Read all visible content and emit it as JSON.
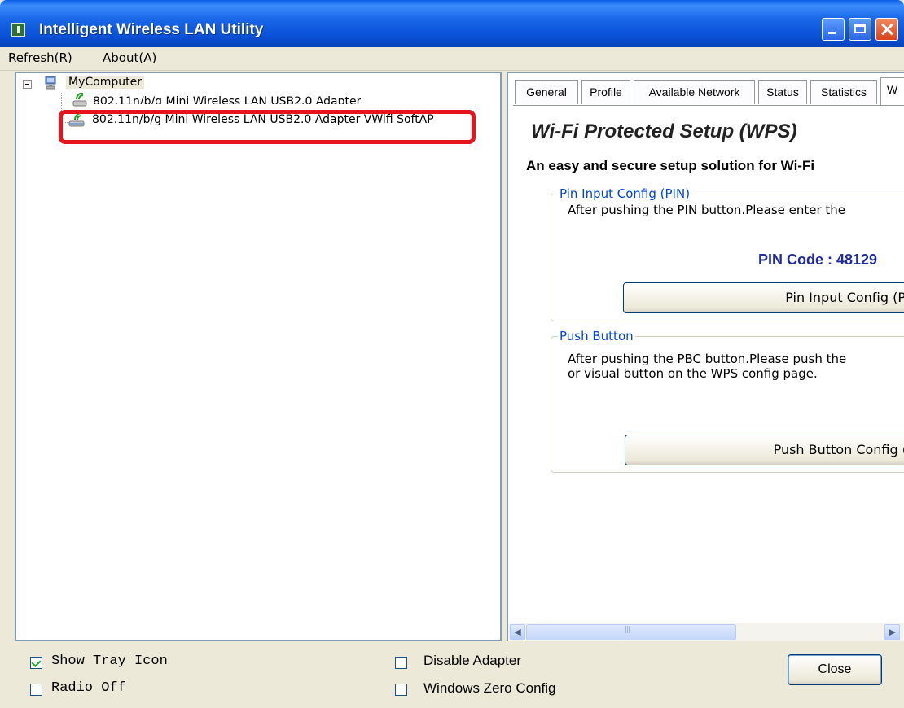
{
  "window": {
    "title": "Intelligent Wireless LAN Utility"
  },
  "menu": {
    "refresh": "Refresh(R)",
    "about": "About(A)"
  },
  "tree": {
    "root": "MyComputer",
    "adapters": [
      "802.11n/b/g Mini Wireless LAN USB2.0 Adapter",
      "802.11n/b/g Mini Wireless LAN USB2.0 Adapter VWifi SoftAP"
    ],
    "highlighted_index": 1,
    "highlight_color": "#e8141b"
  },
  "tabs": [
    "General",
    "Profile",
    "Available Network",
    "Status",
    "Statistics",
    "W"
  ],
  "active_tab": "W",
  "wps": {
    "title": "Wi-Fi Protected Setup (WPS)",
    "subtitle": "An easy and secure setup solution for Wi-Fi",
    "pin_group": {
      "legend": "Pin Input Config (PIN)",
      "text": "After pushing the PIN button.Please enter the",
      "pin_code": "PIN Code : 48129",
      "button": "Pin Input Config (P"
    },
    "push_group": {
      "legend": "Push Button",
      "text_line1": "After pushing the PBC button.Please push the",
      "text_line2": "or visual button on the WPS config page.",
      "button": "Push Button Config ("
    }
  },
  "options": {
    "show_tray_icon": {
      "label": "Show Tray Icon",
      "checked": true
    },
    "radio_off": {
      "label": "Radio Off",
      "checked": false
    },
    "disable_adapter": {
      "label": "Disable Adapter",
      "checked": false
    },
    "windows_zero_config": {
      "label": "Windows Zero Config",
      "checked": false
    }
  },
  "buttons": {
    "close": "Close"
  },
  "icons": {
    "app": "wireless-app-icon",
    "minimize": "minimize-icon",
    "maximize": "maximize-icon",
    "close": "close-x-icon",
    "computer": "computer-icon",
    "adapter": "wireless-adapter-icon",
    "scroll_left": "scroll-left-arrow-icon",
    "scroll_right": "scroll-right-arrow-icon"
  },
  "colors": {
    "titlebar": "#0a52d8",
    "group_legend": "#0046d5",
    "pin_code": "#1f2c99"
  }
}
